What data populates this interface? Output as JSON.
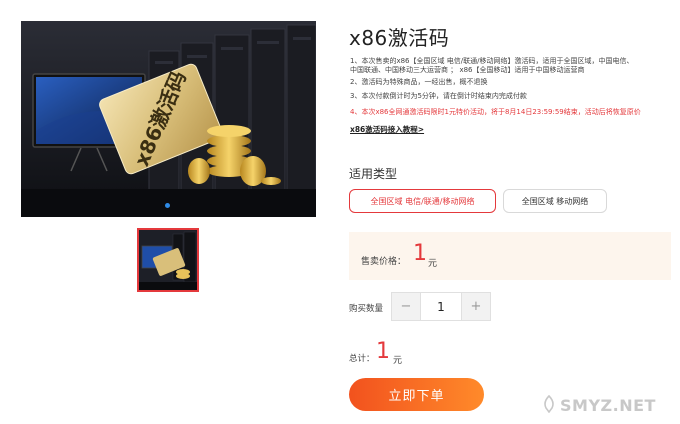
{
  "product": {
    "title": "x86激活码",
    "desc": [
      "1、本次售卖的x86【全国区域 电信/联通/移动网络】激活码，适用于全国区域，中国电信、",
      "中国联通、中国移动三大运营商 ； x86【全国移动】适用于中国移动运营商",
      "2、激活码为特殊商品，一经出售，概不退换",
      "3、本次付款倒计时为5分钟，请在倒计时结束内完成付款",
      "4、本次x86全网通激活码限时1元特价活动，将于8月14日23:59:59结束，活动后将恢复原价"
    ],
    "guide_link": "x86激活码接入教程>",
    "card_text": "x86激活码"
  },
  "options": {
    "label": "适用类型",
    "items": [
      "全国区域 电信/联通/移动网络",
      "全国区域 移动网络"
    ],
    "selected_index": 0
  },
  "price": {
    "label": "售卖价格：",
    "value": "1",
    "unit": "元"
  },
  "quantity": {
    "label": "购买数量",
    "value": "1",
    "minus": "−",
    "plus": "+"
  },
  "total": {
    "label": "总计：",
    "value": "1",
    "unit": "元"
  },
  "buy_button": "立即下单",
  "watermark": "SMYZ.NET",
  "colors": {
    "accent": "#e4393c",
    "button_start": "#f2521e",
    "button_end": "#ff8a2a",
    "price_bg": "#fdf5ed"
  }
}
